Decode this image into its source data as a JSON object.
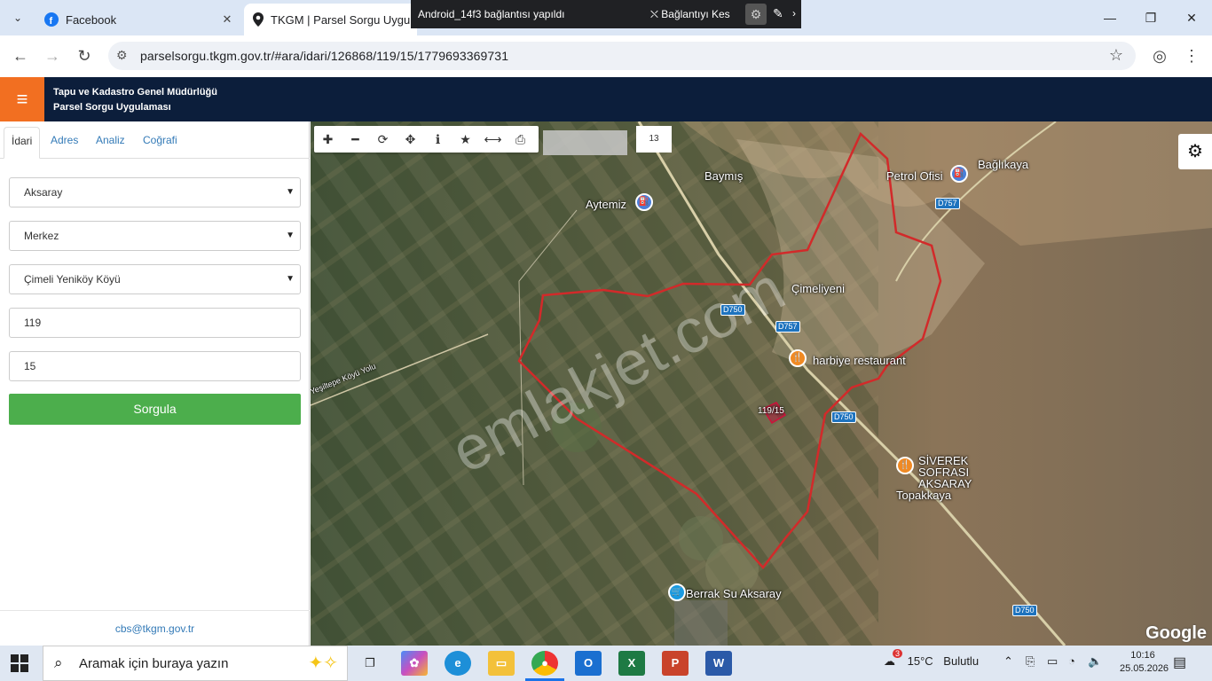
{
  "browser": {
    "tabs": [
      {
        "title": "Facebook",
        "icon": "facebook-icon"
      },
      {
        "title": "TKGM | Parsel Sorgu Uygulama",
        "icon": "location-pin-icon"
      }
    ],
    "url": "parselsorgu.tkgm.gov.tr/#ara/idari/126868/119/15/1779693369731"
  },
  "remote_bar": {
    "title": "Android_14f3 bağlantısı yapıldı",
    "disconnect_label": "Bağlantıyı Kes"
  },
  "app_header": {
    "line1": "Tapu ve Kadastro Genel Müdürlüğü",
    "line2": "Parsel Sorgu Uygulaması"
  },
  "panel": {
    "tabs": [
      "İdari",
      "Adres",
      "Analiz",
      "Coğrafi"
    ],
    "province": "Aksaray",
    "district": "Merkez",
    "neighborhood": "Çimeli Yeniköy Köyü",
    "block": "119",
    "parcel": "15",
    "query_button": "Sorgula",
    "footer_email": "cbs@tkgm.gov.tr"
  },
  "map": {
    "zoom_level": "13",
    "parcel_label": "119/15",
    "attribution": "Google",
    "places": [
      "Baymış",
      "Aytemiz",
      "Petrol Ofisi",
      "Bağlıkaya",
      "Çimeliyeni",
      "harbiye restaurant",
      "SİVEREK SOFRASI AKSARAY",
      "Topakkaya",
      "Berrak Su Aksaray",
      "Yeşiltepe Köyü Yolu"
    ],
    "roads": [
      "D757",
      "D750",
      "D757",
      "D750",
      "D750"
    ],
    "watermark": "emlakjet.com"
  },
  "taskbar": {
    "search_placeholder": "Aramak için buraya yazın",
    "weather_temp": "15°C",
    "weather_text": "Bulutlu",
    "weather_badge": "3",
    "time": "10:16",
    "date": "25.05.2026"
  }
}
